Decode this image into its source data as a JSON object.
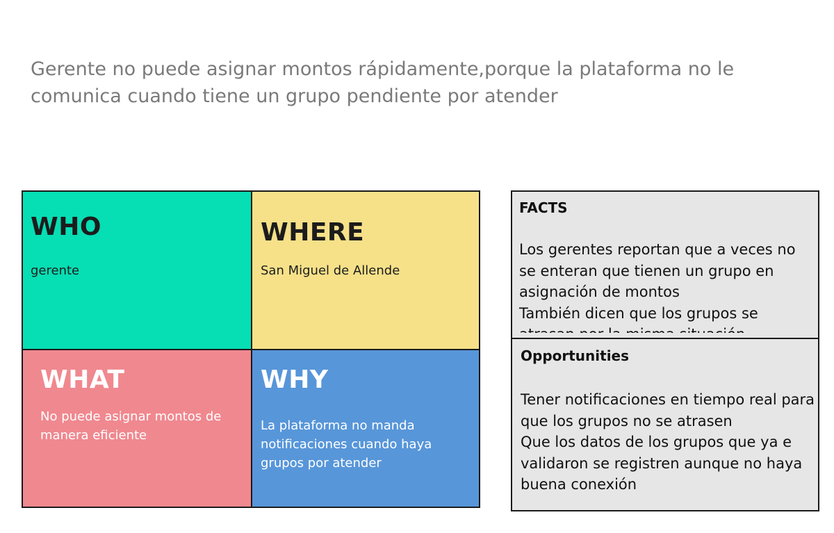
{
  "problem_statement": "Gerente no puede asignar montos rápidamente,porque la plataforma no le comunica cuando tiene un grupo pendiente por atender",
  "quadrants": {
    "who": {
      "title": "WHO",
      "text": "gerente"
    },
    "where": {
      "title": "WHERE",
      "text": "San Miguel de Allende"
    },
    "what": {
      "title": "WHAT",
      "text": "No puede asignar montos de manera eficiente"
    },
    "why": {
      "title": "WHY",
      "text": "La plataforma no manda notificaciones cuando haya grupos por atender"
    }
  },
  "facts": {
    "title": "FACTS",
    "lines": [
      "Los gerentes reportan que a veces no se enteran que tienen un grupo en asignación de montos",
      "También dicen que los grupos se atrasan por la misma situación"
    ]
  },
  "opportunities": {
    "title": "Opportunities",
    "lines": [
      "Tener notificaciones en tiempo real para que los grupos no se atrasen",
      "Que los datos de los grupos que ya e validaron se registren aunque no haya buena conexión"
    ]
  },
  "colors": {
    "who": "#06deb4",
    "where": "#f6e189",
    "what": "#f0888f",
    "why": "#5796d9",
    "side_box": "#e6e6e6"
  }
}
